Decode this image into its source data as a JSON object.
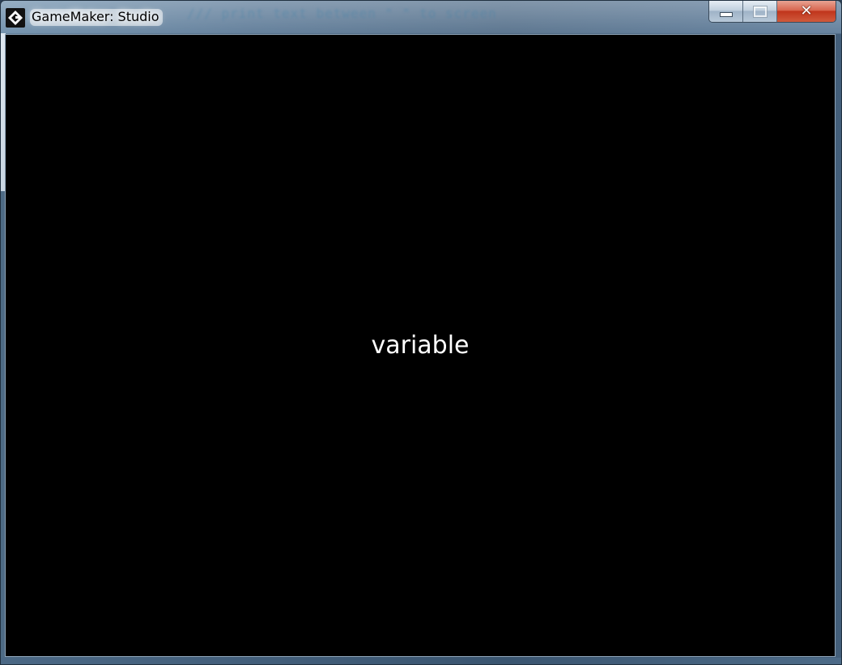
{
  "window": {
    "title": "GameMaker: Studio",
    "app_icon": "gamemaker-logo-icon",
    "background_code_text": "/// print text between \" \" to screen"
  },
  "controls": {
    "minimize_icon": "minimize-icon",
    "maximize_icon": "maximize-icon",
    "close_icon": "close-icon",
    "close_glyph": "✕",
    "close_color": "#c7381d"
  },
  "game": {
    "text": "variable",
    "background_color": "#000000",
    "text_color": "#ffffff"
  }
}
